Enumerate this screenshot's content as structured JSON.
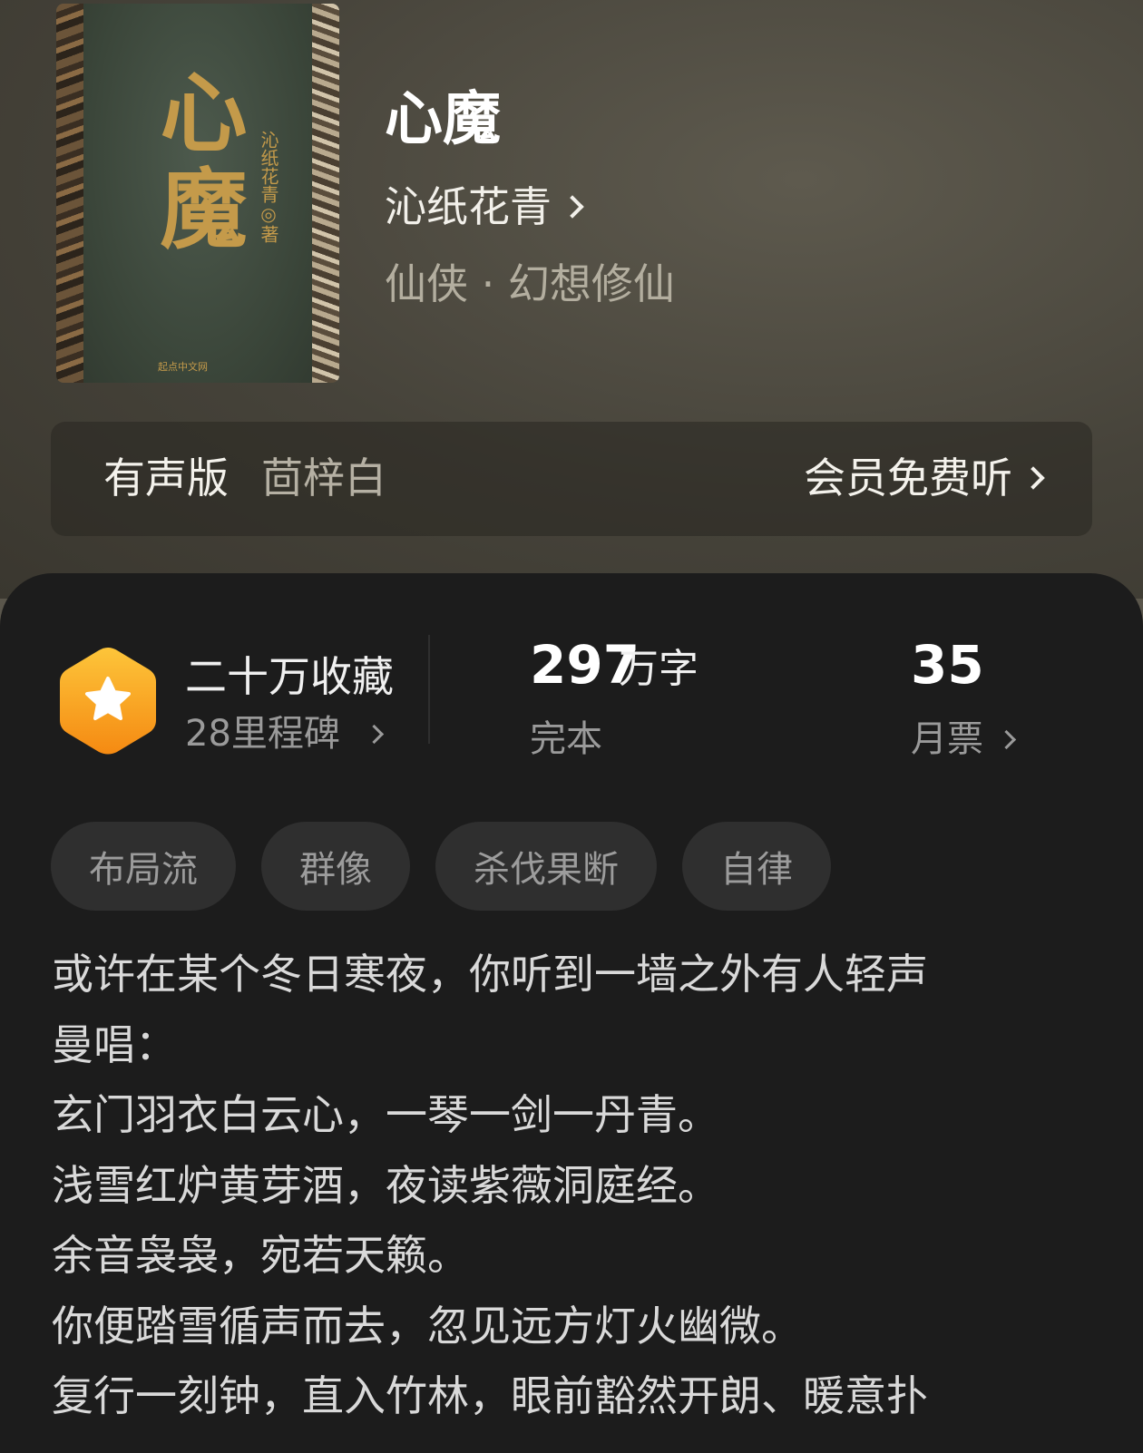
{
  "book": {
    "title": "心魔",
    "author": "沁纸花青",
    "genre": "仙侠 · 幻想修仙",
    "cover": {
      "title": "心魔",
      "author_line": "沁纸花青◎著",
      "publisher": "起点中文网"
    }
  },
  "audio": {
    "label": "有声版",
    "narrator": "茴梓白",
    "cta": "会员免费听"
  },
  "stats": {
    "collection": "二十万收藏",
    "milestones": "28里程碑",
    "word_count": "297",
    "word_unit": "万字",
    "status": "完本",
    "monthly_tickets": "35",
    "monthly_tickets_label": "月票"
  },
  "tags": [
    "布局流",
    "群像",
    "杀伐果断",
    "自律"
  ],
  "synopsis": [
    "或许在某个冬日寒夜，你听到一墙之外有人轻声",
    "曼唱：",
    "玄门羽衣白云心，一琴一剑一丹青。",
    "浅雪红炉黄芽酒，夜读紫薇洞庭经。",
    "余音袅袅，宛若天籁。",
    "你便踏雪循声而去，忽见远方灯火幽微。",
    "复行一刻钟，直入竹林，眼前豁然开朗、暖意扑"
  ],
  "colors": {
    "sheet_bg": "#1c1c1c",
    "badge_gold": "#f7a51c",
    "tag_bg": "#2f2f2f"
  }
}
